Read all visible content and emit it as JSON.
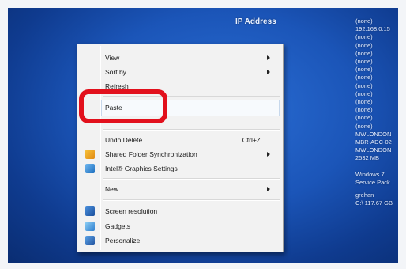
{
  "bginfo": {
    "header": "IP Address",
    "values_top": [
      "(none)",
      "192.168.0.15",
      "(none)",
      "(none)",
      "(none)",
      "(none)",
      "(none)",
      "(none)",
      "(none)",
      "(none)",
      "(none)",
      "(none)",
      "(none)",
      "(none)",
      "MWLONDON",
      "MBR-ADC-02",
      "MWLONDON",
      "2532 MB"
    ],
    "values_bottom": [
      "Windows 7",
      "Service Pack",
      "",
      "grehan",
      "C:\\ 117.67 GB"
    ]
  },
  "context_menu": {
    "items": [
      {
        "label": "View",
        "submenu": true
      },
      {
        "label": "Sort by",
        "submenu": true
      },
      {
        "label": "Refresh"
      },
      {
        "label": "Paste"
      },
      {
        "label": "Undo Delete",
        "shortcut": "Ctrl+Z"
      },
      {
        "label": "Shared Folder Synchronization",
        "submenu": true,
        "icon": "sync-folder-icon"
      },
      {
        "label": "Intel® Graphics Settings",
        "icon": "intel-graphics-icon"
      },
      {
        "label": "New",
        "submenu": true
      },
      {
        "label": "Screen resolution",
        "icon": "screen-resolution-icon"
      },
      {
        "label": "Gadgets",
        "icon": "gadgets-icon"
      },
      {
        "label": "Personalize",
        "icon": "personalize-icon"
      }
    ]
  },
  "colors": {
    "highlight": "#e2101c",
    "desktop": "#1b55b8"
  }
}
